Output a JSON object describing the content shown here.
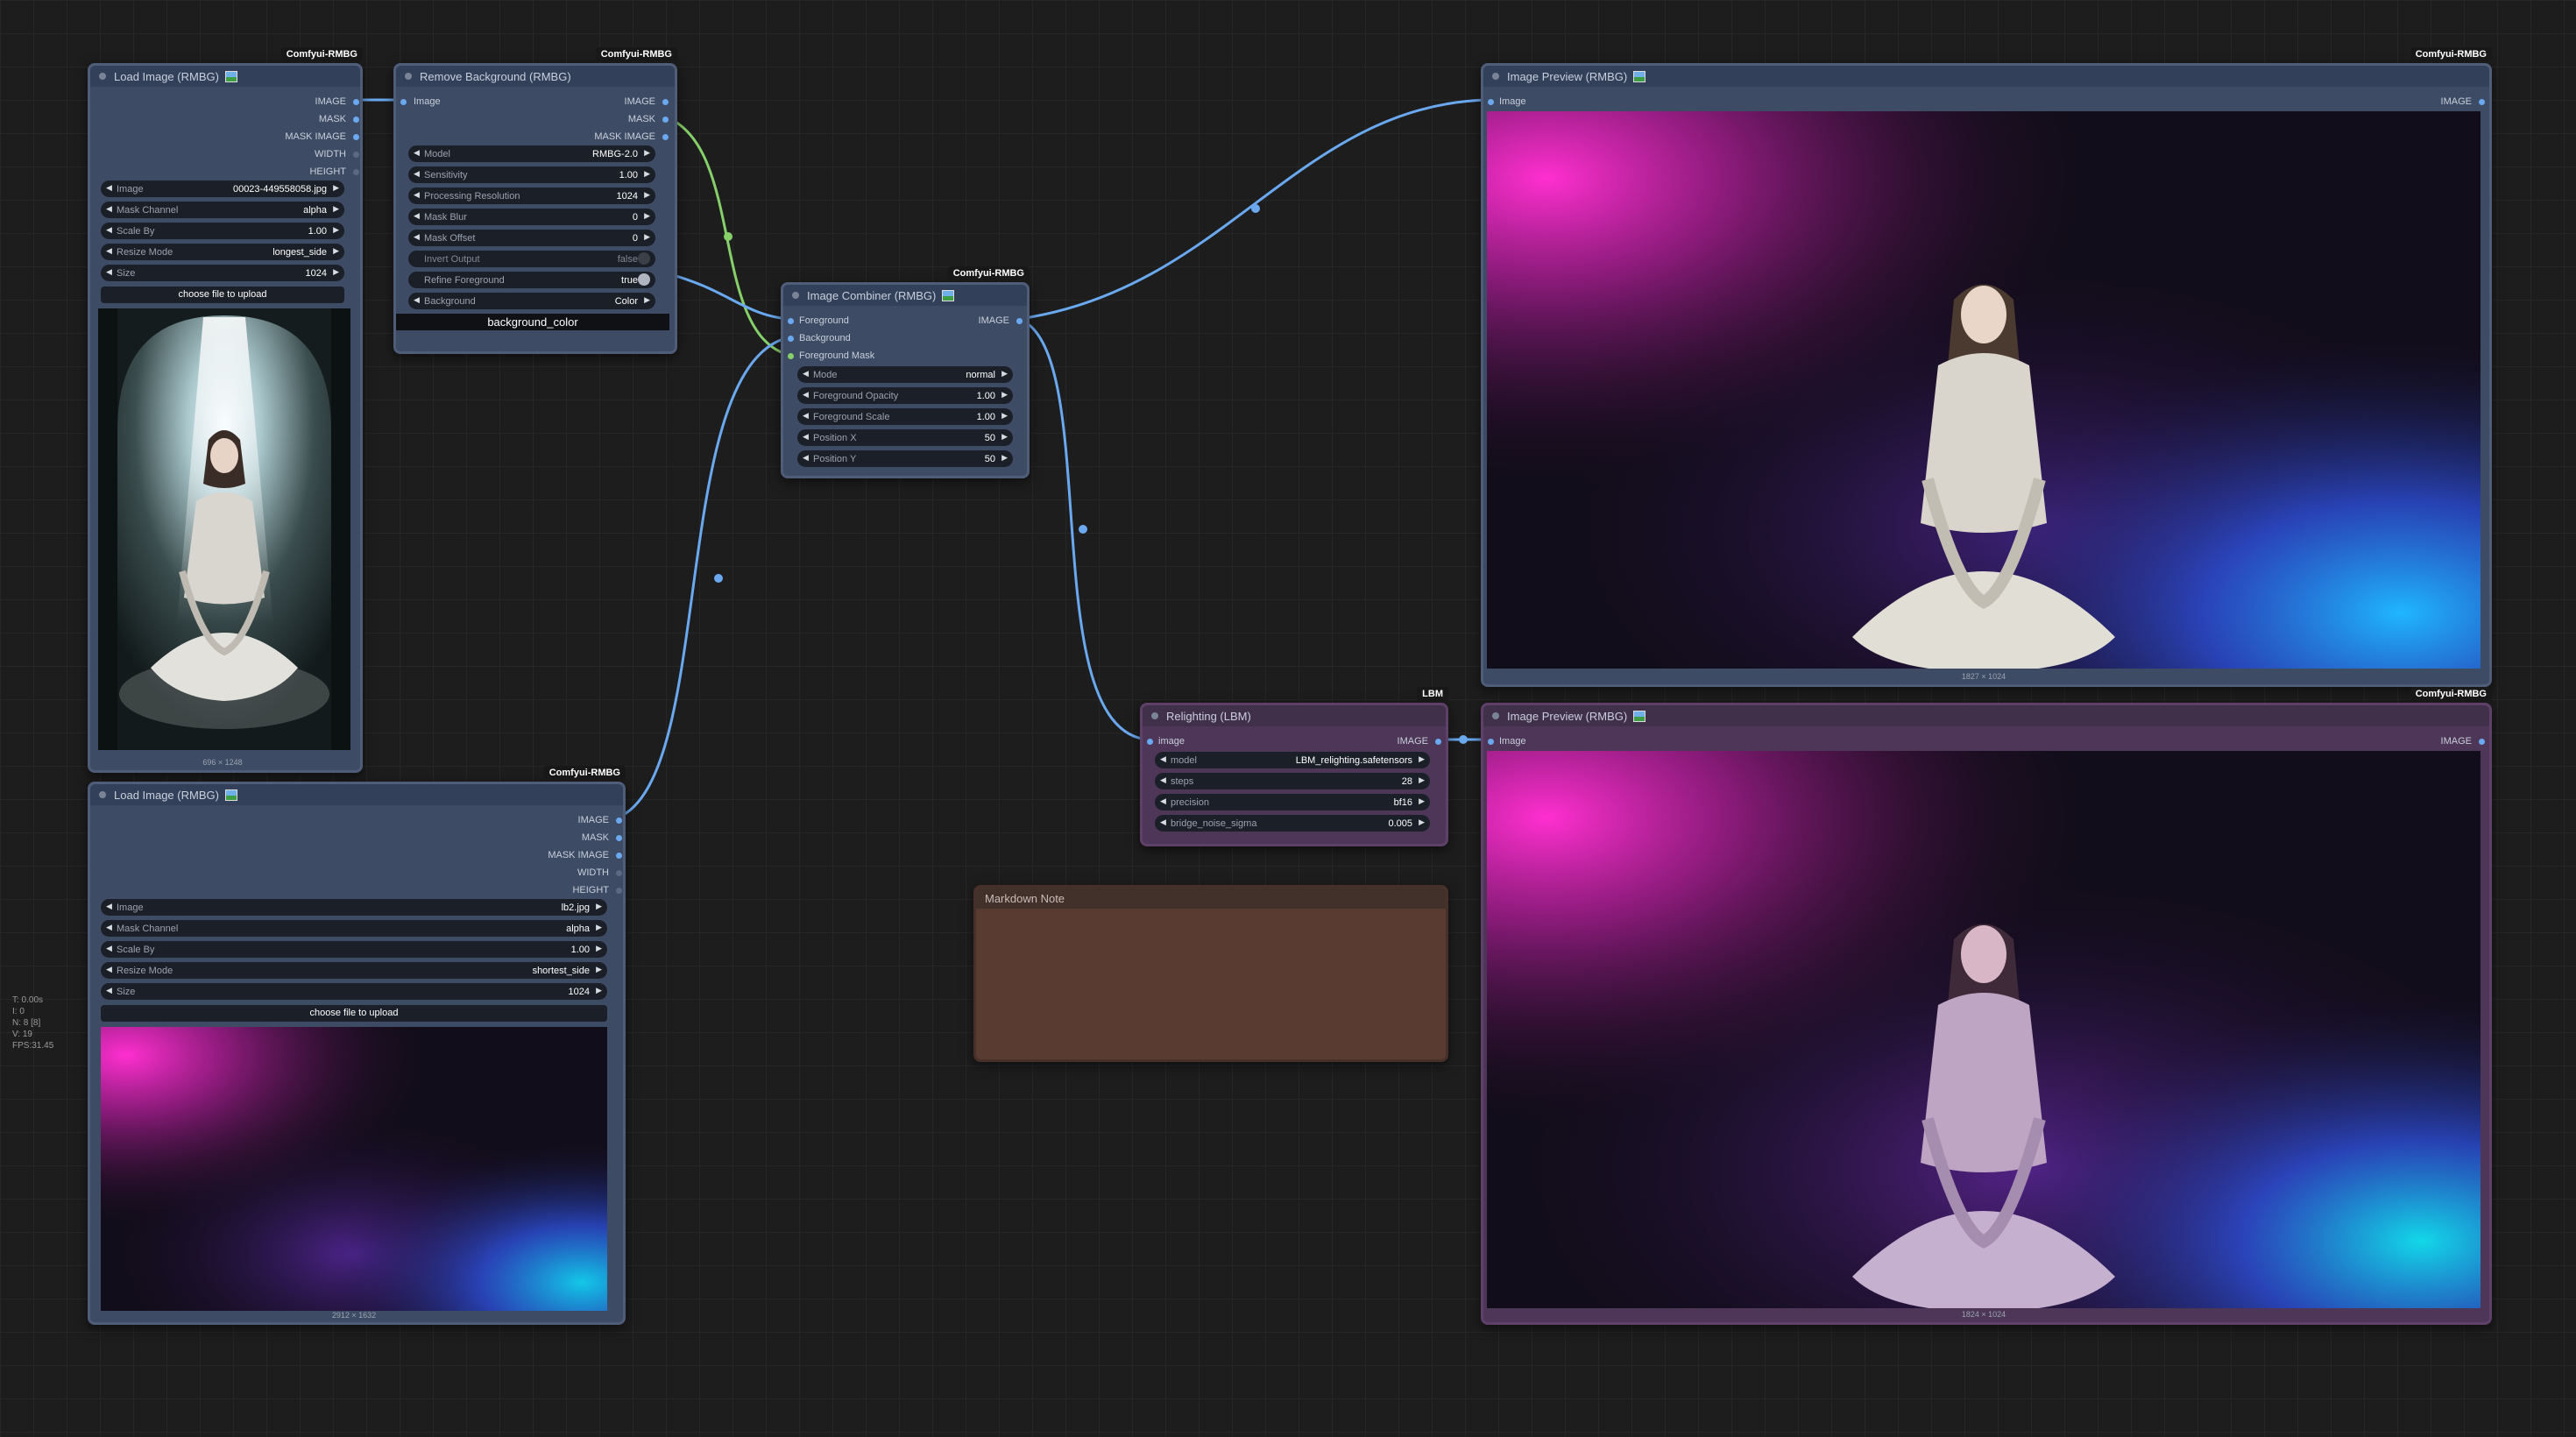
{
  "stats": {
    "line1": "T: 0.00s",
    "line2": "I: 0",
    "line3": "N: 8 [8]",
    "line4": "V: 19",
    "line5": "FPS:31.45"
  },
  "load1": {
    "title": "Load Image (RMBG)",
    "badge": "Comfyui-RMBG",
    "outputs": [
      "IMAGE",
      "MASK",
      "MASK IMAGE",
      "WIDTH",
      "HEIGHT"
    ],
    "widgets": [
      {
        "label": "Image",
        "value": "00023-449558058.jpg"
      },
      {
        "label": "Mask Channel",
        "value": "alpha"
      },
      {
        "label": "Scale By",
        "value": "1.00"
      },
      {
        "label": "Resize Mode",
        "value": "longest_side"
      },
      {
        "label": "Size",
        "value": "1024"
      }
    ],
    "upload": "choose file to upload",
    "dims": "696 × 1248"
  },
  "load2": {
    "title": "Load Image (RMBG)",
    "badge": "Comfyui-RMBG",
    "outputs": [
      "IMAGE",
      "MASK",
      "MASK IMAGE",
      "WIDTH",
      "HEIGHT"
    ],
    "widgets": [
      {
        "label": "Image",
        "value": "lb2.jpg"
      },
      {
        "label": "Mask Channel",
        "value": "alpha"
      },
      {
        "label": "Scale By",
        "value": "1.00"
      },
      {
        "label": "Resize Mode",
        "value": "shortest_side"
      },
      {
        "label": "Size",
        "value": "1024"
      }
    ],
    "upload": "choose file to upload",
    "dims": "2912 × 1632"
  },
  "removebg": {
    "title": "Remove Background (RMBG)",
    "badge": "Comfyui-RMBG",
    "input": "Image",
    "outputs": [
      "IMAGE",
      "MASK",
      "MASK IMAGE"
    ],
    "widgets": [
      {
        "label": "Model",
        "value": "RMBG-2.0"
      },
      {
        "label": "Sensitivity",
        "value": "1.00"
      },
      {
        "label": "Processing Resolution",
        "value": "1024"
      },
      {
        "label": "Mask Blur",
        "value": "0"
      },
      {
        "label": "Mask Offset",
        "value": "0"
      },
      {
        "label": "Invert Output",
        "value": "false"
      },
      {
        "label": "Refine Foreground",
        "value": "true"
      },
      {
        "label": "Background",
        "value": "Color"
      }
    ],
    "bgfield": "background_color"
  },
  "combiner": {
    "title": "Image Combiner (RMBG)",
    "badge": "Comfyui-RMBG",
    "inputs": [
      "Foreground",
      "Background",
      "Foreground Mask"
    ],
    "output": "IMAGE",
    "widgets": [
      {
        "label": "Mode",
        "value": "normal"
      },
      {
        "label": "Foreground Opacity",
        "value": "1.00"
      },
      {
        "label": "Foreground Scale",
        "value": "1.00"
      },
      {
        "label": "Position X",
        "value": "50"
      },
      {
        "label": "Position Y",
        "value": "50"
      }
    ]
  },
  "preview1": {
    "title": "Image Preview (RMBG)",
    "badge": "Comfyui-RMBG",
    "input": "Image",
    "output": "IMAGE",
    "dims": "1827 × 1024"
  },
  "preview2": {
    "title": "Image Preview (RMBG)",
    "badge": "Comfyui-RMBG",
    "input": "Image",
    "output": "IMAGE",
    "dims": "1824 × 1024"
  },
  "relight": {
    "title": "Relighting (LBM)",
    "badge": "LBM",
    "input": "image",
    "output": "IMAGE",
    "widgets": [
      {
        "label": "model",
        "value": "LBM_relighting.safetensors"
      },
      {
        "label": "steps",
        "value": "28"
      },
      {
        "label": "precision",
        "value": "bf16"
      },
      {
        "label": "bridge_noise_sigma",
        "value": "0.005"
      }
    ]
  },
  "note": {
    "title": "Markdown Note"
  },
  "colors": {
    "wire_image": "#6aa9f0",
    "wire_mask": "#86d06a",
    "node_bg": "#3e4b64",
    "node_purple": "#4d3658",
    "note_bg": "#5a3b31"
  }
}
